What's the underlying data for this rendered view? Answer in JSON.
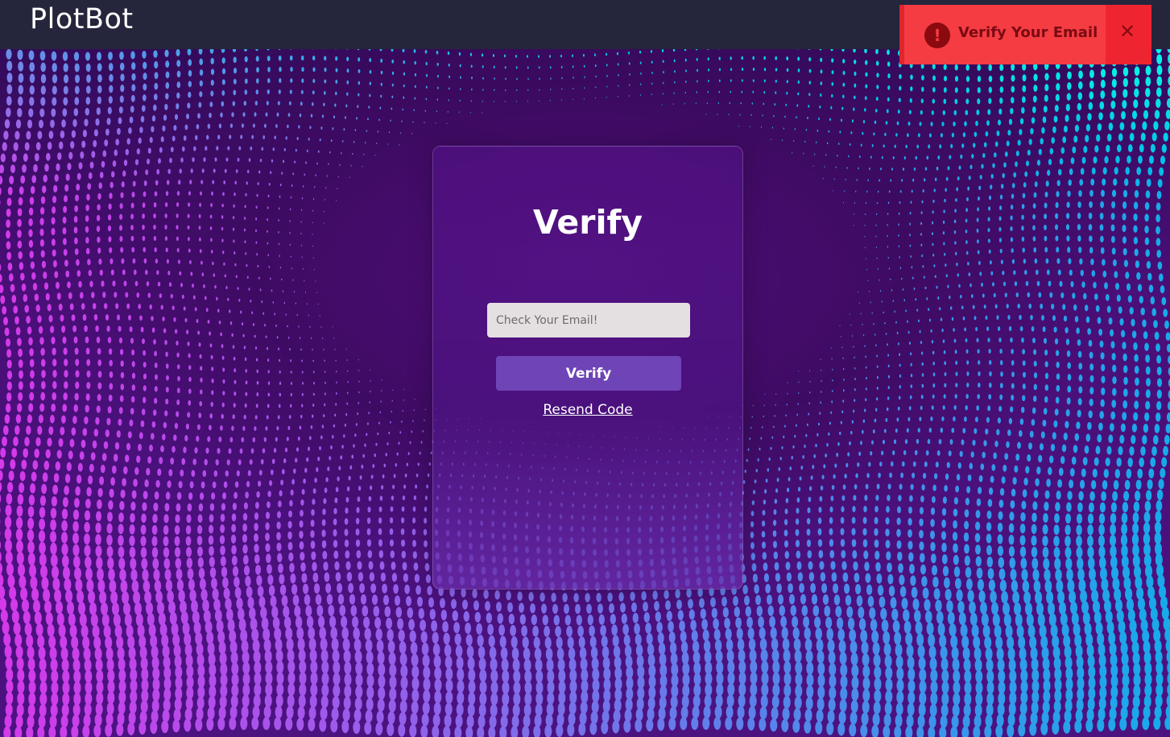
{
  "header": {
    "brand": "PlotBot"
  },
  "card": {
    "title": "Verify",
    "code_input": {
      "value": "",
      "placeholder": "Check Your Email!"
    },
    "verify_button_label": "Verify",
    "resend_link_label": "Resend Code"
  },
  "toast": {
    "message": "Verify Your Email",
    "icon": "exclamation-circle-icon",
    "close_icon": "close-icon",
    "close_glyph": "✕",
    "icon_glyph": "!"
  },
  "colors": {
    "topbar": "#25253b",
    "toast": "#f53c43",
    "button": "#6e44b6",
    "background": "#3a0a5e"
  }
}
